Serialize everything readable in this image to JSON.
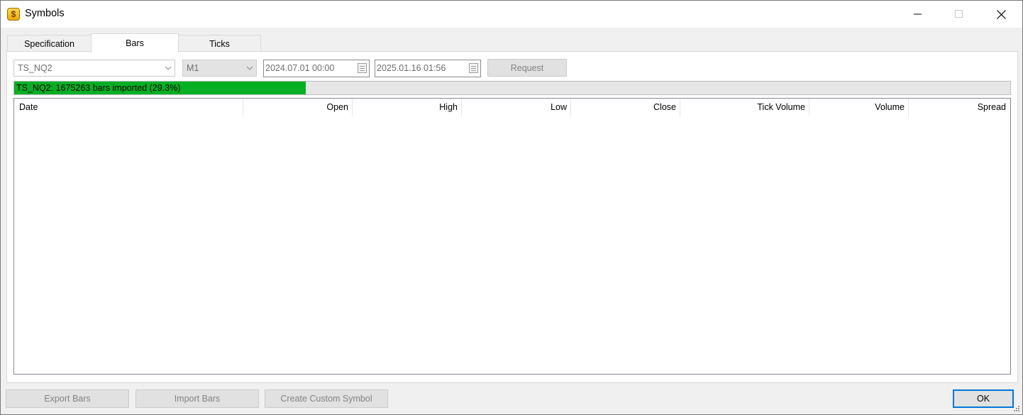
{
  "window": {
    "title": "Symbols",
    "app_icon_glyph": "$"
  },
  "tabs": [
    {
      "label": "Specification",
      "active": false
    },
    {
      "label": "Bars",
      "active": true
    },
    {
      "label": "Ticks",
      "active": false
    }
  ],
  "toolbar": {
    "symbol": "TS_NQ2",
    "timeframe": "M1",
    "date_from": "2024.07.01 00:00",
    "date_to": "2025.01.16 01:56",
    "request_label": "Request"
  },
  "progress": {
    "text": "TS_NQ2: 1675263 bars imported (29.3%)",
    "percent": 29.3,
    "color": "#06b025"
  },
  "table": {
    "columns": [
      "Date",
      "Open",
      "High",
      "Low",
      "Close",
      "Tick Volume",
      "Volume",
      "Spread"
    ],
    "rows": []
  },
  "footer": {
    "export_label": "Export Bars",
    "import_label": "Import Bars",
    "custom_label": "Create Custom Symbol",
    "ok_label": "OK"
  },
  "colors": {
    "accent": "#0078d7"
  }
}
